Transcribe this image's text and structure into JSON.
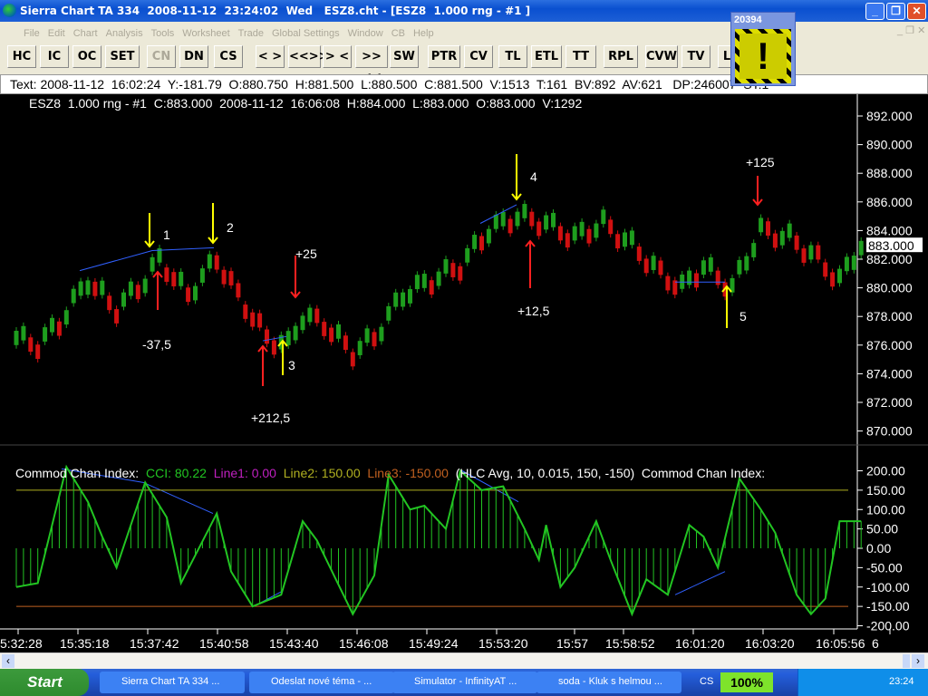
{
  "window": {
    "title": "Sierra Chart TA 334  2008-11-12  23:24:02  Wed   ESZ8.cht - [ESZ8  1.000 rng - #1 ]",
    "min": "_",
    "restore": "❐",
    "close": "✕"
  },
  "menu": [
    "File",
    "Edit",
    "Chart",
    "Analysis",
    "Tools",
    "Worksheet",
    "Trade",
    "Global Settings",
    "Window",
    "CB",
    "Help"
  ],
  "toolbar": [
    "HC",
    "IC",
    "OC",
    "SET",
    "CN",
    "DN",
    "CS",
    "< >",
    "<<>>",
    "> <",
    ">><<",
    "SW",
    "PTR",
    "CV",
    "TL",
    "ETL",
    "TT",
    "RPL",
    "CVW",
    "TV",
    "L"
  ],
  "status_line": "Text: 2008-11-12  16:02:24  Y:-181.79  O:880.750  H:881.500  L:880.500  C:881.500  V:1513  T:161  BV:892  AV:621   DP:246007  ST:1",
  "alert": {
    "count": "20394",
    "icon": "warning-exclamation-icon"
  },
  "chart_header": "ESZ8  1.000 rng - #1  C:883.000  2008-11-12  16:06:08  H:884.000  L:883.000  O:883.000  V:1292",
  "price_axis": [
    "892.000",
    "890.000",
    "888.000",
    "886.000",
    "884.000",
    "882.000",
    "880.000",
    "878.000",
    "876.000",
    "874.000",
    "872.000",
    "870.000"
  ],
  "last_price": "883.000",
  "cci_header": {
    "name": "Commod Chan Index:",
    "cci": "CCI: 80.22",
    "line1": "Line1: 0.00",
    "line2": "Line2: 150.00",
    "line3": "Line3: -150.00",
    "params": "(HLC Avg, 10, 0.015, 150, -150)",
    "name2": "Commod Chan Index:"
  },
  "cci_axis": [
    "200.00",
    "150.00",
    "100.00",
    "50.00",
    "0.00",
    "-50.00",
    "-100.00",
    "-150.00",
    "-200.00"
  ],
  "time_axis": [
    "5:32:28",
    "15:35:18",
    "15:37:42",
    "15:40:58",
    "15:43:40",
    "15:46:08",
    "15:49:24",
    "15:53:20",
    "15:57",
    "15:58:52",
    "16:01:20",
    "16:03:20",
    "16:05:56",
    "6"
  ],
  "colors": {
    "up": "#1e9e1e",
    "down": "#d01010",
    "cci": "#22c522",
    "line2": "#b0b020",
    "line3": "#c06020",
    "trend": "#3060ff",
    "yellow_arrow": "#ffff00",
    "red_arrow": "#ff2020"
  },
  "chart_data": {
    "type": "bar",
    "price_path": [
      [
        0,
        877
      ],
      [
        3,
        876.5
      ],
      [
        6,
        878
      ],
      [
        10,
        881
      ],
      [
        14,
        879
      ],
      [
        18,
        881
      ],
      [
        20,
        882.5
      ],
      [
        24,
        880
      ],
      [
        28,
        882.5
      ],
      [
        31,
        880
      ],
      [
        35,
        877
      ],
      [
        38,
        876.5
      ],
      [
        40,
        878.5
      ],
      [
        43,
        878
      ],
      [
        47,
        876
      ],
      [
        50,
        877
      ],
      [
        54,
        880
      ],
      [
        58,
        881
      ],
      [
        62,
        882
      ],
      [
        66,
        884.5
      ],
      [
        70,
        885.5
      ],
      [
        74,
        885
      ],
      [
        78,
        884
      ],
      [
        82,
        885
      ],
      [
        86,
        883.5
      ],
      [
        90,
        881.5
      ],
      [
        93,
        880.5
      ],
      [
        96,
        882
      ],
      [
        100,
        880.5
      ],
      [
        104,
        884.5
      ],
      [
        108,
        884
      ],
      [
        112,
        882.5
      ],
      [
        115,
        881
      ],
      [
        118,
        883.5
      ]
    ],
    "cci_path": [
      [
        0,
        -100
      ],
      [
        3,
        -90
      ],
      [
        7,
        210
      ],
      [
        10,
        120
      ],
      [
        12,
        30
      ],
      [
        14,
        -50
      ],
      [
        18,
        170
      ],
      [
        21,
        80
      ],
      [
        23,
        -90
      ],
      [
        28,
        90
      ],
      [
        30,
        -60
      ],
      [
        33,
        -150
      ],
      [
        37,
        -120
      ],
      [
        40,
        70
      ],
      [
        42,
        20
      ],
      [
        47,
        -170
      ],
      [
        50,
        -70
      ],
      [
        52,
        190
      ],
      [
        55,
        100
      ],
      [
        57,
        110
      ],
      [
        60,
        50
      ],
      [
        62,
        200
      ],
      [
        65,
        150
      ],
      [
        68,
        160
      ],
      [
        71,
        50
      ],
      [
        73,
        -30
      ],
      [
        74,
        60
      ],
      [
        76,
        -100
      ],
      [
        78,
        -50
      ],
      [
        81,
        70
      ],
      [
        83,
        -30
      ],
      [
        86,
        -170
      ],
      [
        88,
        -80
      ],
      [
        91,
        -120
      ],
      [
        94,
        60
      ],
      [
        96,
        30
      ],
      [
        98,
        -50
      ],
      [
        101,
        180
      ],
      [
        104,
        100
      ],
      [
        106,
        40
      ],
      [
        109,
        -120
      ],
      [
        111,
        -170
      ],
      [
        113,
        -130
      ],
      [
        115,
        70
      ]
    ],
    "annotations": {
      "labels": [
        "1",
        "2",
        "3",
        "4",
        "5",
        "+25",
        "-37,5",
        "+212,5",
        "+12,5",
        "+125"
      ]
    }
  },
  "scrollbar": {
    "left": "‹",
    "right": "›"
  },
  "taskbar": {
    "start": "Start",
    "tasks": [
      "Sierra Chart TA 334 ...",
      "Odeslat nové téma - ...",
      "Simulator - InfinityAT ...",
      "soda - Kluk s helmou ..."
    ],
    "lang": "CS",
    "battery": "100%",
    "clock": "23:24"
  }
}
